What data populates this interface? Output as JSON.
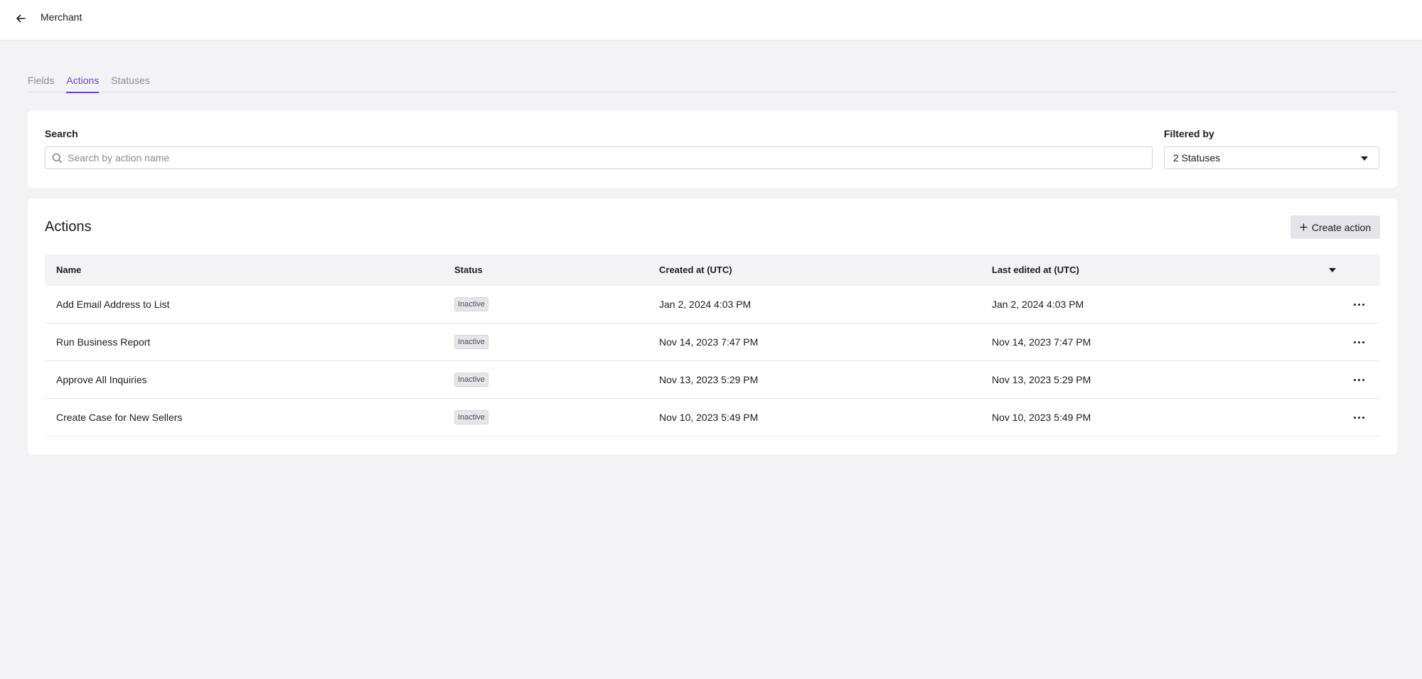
{
  "header": {
    "title": "Merchant"
  },
  "tabs": [
    {
      "label": "Fields",
      "active": false
    },
    {
      "label": "Actions",
      "active": true
    },
    {
      "label": "Statuses",
      "active": false
    }
  ],
  "search": {
    "label": "Search",
    "placeholder": "Search by action name",
    "value": ""
  },
  "filter": {
    "label": "Filtered by",
    "value": "2 Statuses"
  },
  "actions": {
    "title": "Actions",
    "create_label": "Create action",
    "columns": {
      "name": "Name",
      "status": "Status",
      "created": "Created at (UTC)",
      "edited": "Last edited at (UTC)"
    },
    "rows": [
      {
        "name": "Add Email Address to List",
        "status": "Inactive",
        "created": "Jan 2, 2024 4:03 PM",
        "edited": "Jan 2, 2024 4:03 PM"
      },
      {
        "name": "Run Business Report",
        "status": "Inactive",
        "created": "Nov 14, 2023 7:47 PM",
        "edited": "Nov 14, 2023 7:47 PM"
      },
      {
        "name": "Approve All Inquiries",
        "status": "Inactive",
        "created": "Nov 13, 2023 5:29 PM",
        "edited": "Nov 13, 2023 5:29 PM"
      },
      {
        "name": "Create Case for New Sellers",
        "status": "Inactive",
        "created": "Nov 10, 2023 5:49 PM",
        "edited": "Nov 10, 2023 5:49 PM"
      }
    ]
  },
  "icons": {
    "back": "arrow-left-icon",
    "search": "search-icon",
    "dropdown": "caret-down-icon",
    "add": "plus-icon",
    "more": "more-horizontal-icon"
  },
  "colors": {
    "accent": "#6b3fe0",
    "background": "#f3f3f5",
    "badge": "#e6e6ea"
  }
}
